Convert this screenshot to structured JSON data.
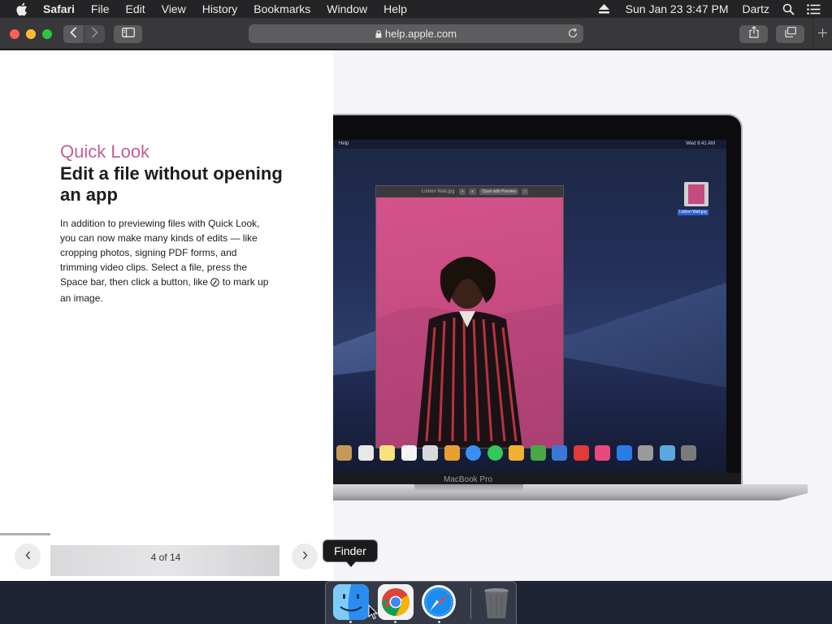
{
  "menubar": {
    "app_name": "Safari",
    "items": [
      "File",
      "Edit",
      "View",
      "History",
      "Bookmarks",
      "Window",
      "Help"
    ],
    "clock": "Sun Jan 23  3:47 PM",
    "user": "Dartz",
    "icons": [
      "apple-icon",
      "eject-icon",
      "spotlight-icon",
      "notification-center-icon"
    ]
  },
  "toolbar": {
    "url": "help.apple.com",
    "icons": [
      "back-icon",
      "forward-icon",
      "sidebar-icon",
      "lock-icon",
      "reload-icon",
      "share-icon",
      "tabs-overview-icon",
      "new-tab-icon"
    ],
    "traffic_colors": [
      "#ff5f57",
      "#febc2e",
      "#28c840"
    ]
  },
  "article": {
    "kicker": "Quick Look",
    "headline": "Edit a file without opening an app",
    "body_before_icon": "In addition to previewing files with Quick Look, you can now make many kinds of edits — like cropping photos, signing PDF forms, and trimming video clips. Select a file, press the Space bar, then click a button, like ",
    "body_after_icon": " to mark up an image.",
    "markup_icon": "markup-icon",
    "accent_color": "#c75d96"
  },
  "pager": {
    "label": "4 of 14",
    "prev_icon": "chevron-left-icon",
    "next_icon": "chevron-right-icon"
  },
  "illustration": {
    "mini_menubar_left": "Help",
    "mini_menubar_right": "Wed 9:41 AM",
    "quicklook_filename": "Lisbon Wall.jpg",
    "quicklook_button": "Open with Preview",
    "desktop_file_label": "Lisbon Wall.jpg",
    "laptop_label": "MacBook Pro",
    "mini_dock_colors": [
      "#c49a5a",
      "#e8e8e8",
      "#f5e27a",
      "#f4f4f4",
      "#d8d8d8",
      "#e8a030",
      "#3a8ef0",
      "#34c759",
      "#f0b030",
      "#48a848",
      "#3a78d8",
      "#e03a3a",
      "#e84a7a",
      "#2a7ae8",
      "#9a9a9a",
      "#5aa8e0",
      "#7a7a7a"
    ]
  },
  "dock": {
    "items": [
      "Finder",
      "Google Chrome",
      "Safari",
      "Trash"
    ],
    "tooltip": "Finder"
  }
}
